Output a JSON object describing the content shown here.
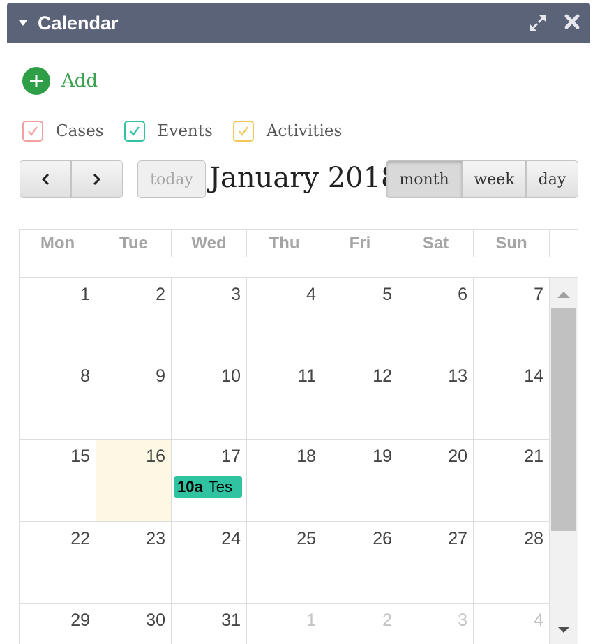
{
  "panel": {
    "title": "Calendar",
    "icons": [
      "collapse-triangle-icon",
      "expand-icon",
      "close-icon"
    ]
  },
  "add": {
    "label": "Add",
    "icon": "plus-icon",
    "color": "#2e9e47"
  },
  "filters": [
    {
      "label": "Cases",
      "color": "#f2a1a1",
      "checked": true
    },
    {
      "label": "Events",
      "color": "#2fc3a1",
      "checked": true
    },
    {
      "label": "Activities",
      "color": "#f3c85a",
      "checked": true
    }
  ],
  "toolbar": {
    "prev_icon": "chevron-left-icon",
    "next_icon": "chevron-right-icon",
    "today_label": "today",
    "title": "January 2018",
    "views": [
      "month",
      "week",
      "day"
    ],
    "active_view": "month"
  },
  "calendar": {
    "days_of_week": [
      "Mon",
      "Tue",
      "Wed",
      "Thu",
      "Fri",
      "Sat",
      "Sun"
    ],
    "today": "16",
    "weeks": [
      [
        {
          "d": "1"
        },
        {
          "d": "2"
        },
        {
          "d": "3"
        },
        {
          "d": "4"
        },
        {
          "d": "5"
        },
        {
          "d": "6"
        },
        {
          "d": "7"
        }
      ],
      [
        {
          "d": "8"
        },
        {
          "d": "9"
        },
        {
          "d": "10"
        },
        {
          "d": "11"
        },
        {
          "d": "12"
        },
        {
          "d": "13"
        },
        {
          "d": "14"
        }
      ],
      [
        {
          "d": "15"
        },
        {
          "d": "16"
        },
        {
          "d": "17"
        },
        {
          "d": "18"
        },
        {
          "d": "19"
        },
        {
          "d": "20"
        },
        {
          "d": "21"
        }
      ],
      [
        {
          "d": "22"
        },
        {
          "d": "23"
        },
        {
          "d": "24"
        },
        {
          "d": "25"
        },
        {
          "d": "26"
        },
        {
          "d": "27"
        },
        {
          "d": "28"
        }
      ],
      [
        {
          "d": "29"
        },
        {
          "d": "30"
        },
        {
          "d": "31"
        },
        {
          "d": "1",
          "other": true
        },
        {
          "d": "2",
          "other": true
        },
        {
          "d": "3",
          "other": true
        },
        {
          "d": "4",
          "other": true
        }
      ]
    ],
    "events": [
      {
        "week": 2,
        "day": 2,
        "time": "10a",
        "title": "Tes",
        "color": "#2fc3a1"
      }
    ]
  },
  "scrollbar": {
    "up_icon": "scroll-up-arrow-icon",
    "down_icon": "scroll-down-arrow-icon"
  }
}
